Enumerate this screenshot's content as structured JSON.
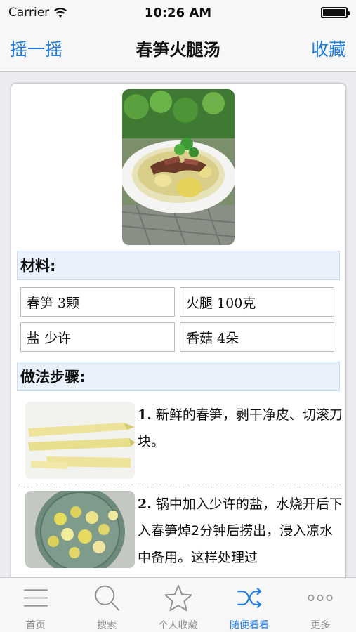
{
  "status": {
    "carrier": "Carrier",
    "time": "10:26 AM"
  },
  "nav": {
    "left": "摇一摇",
    "title": "春笋火腿汤",
    "right": "收藏"
  },
  "sections": {
    "ingredients": "材料:",
    "steps": "做法步骤:"
  },
  "ingredients": [
    "春笋 3颗",
    "火腿 100克",
    "盐 少许",
    "香菇 4朵"
  ],
  "steps": [
    {
      "num": "1.",
      "text": "新鲜的春笋，剥干净皮、切滚刀块。"
    },
    {
      "num": "2.",
      "text": "锅中加入少许的盐，水烧开后下入春笋焯2分钟后捞出，浸入凉水中备用。这样处理过"
    }
  ],
  "tabs": [
    {
      "label": "首页",
      "icon": "menu-icon"
    },
    {
      "label": "搜索",
      "icon": "search-icon"
    },
    {
      "label": "个人收藏",
      "icon": "star-icon"
    },
    {
      "label": "随便看看",
      "icon": "shuffle-icon",
      "active": true
    },
    {
      "label": "更多",
      "icon": "more-icon"
    }
  ],
  "colors": {
    "accent": "#1f7de0",
    "inactive": "#8e8e93",
    "section_bg": "#e8f1fc"
  }
}
